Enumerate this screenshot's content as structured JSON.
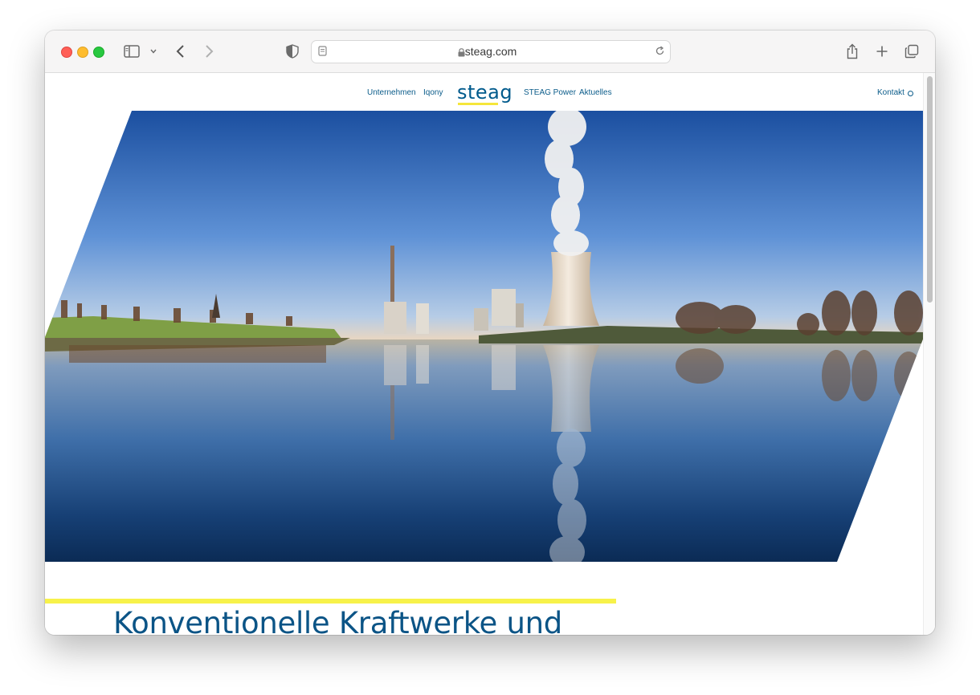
{
  "browser": {
    "url": "steag.com"
  },
  "nav": {
    "items": [
      "Unternehmen",
      "Iqony",
      "STEAG Power",
      "Aktuelles"
    ],
    "logo": "steag",
    "contact": "Kontakt"
  },
  "hero": {
    "alt": "Power plant with cooling tower reflected in river"
  },
  "content": {
    "headline": "Konventionelle Kraftwerke und"
  },
  "colors": {
    "brand_blue": "#0b5486",
    "accent_yellow": "#f7f24a"
  }
}
